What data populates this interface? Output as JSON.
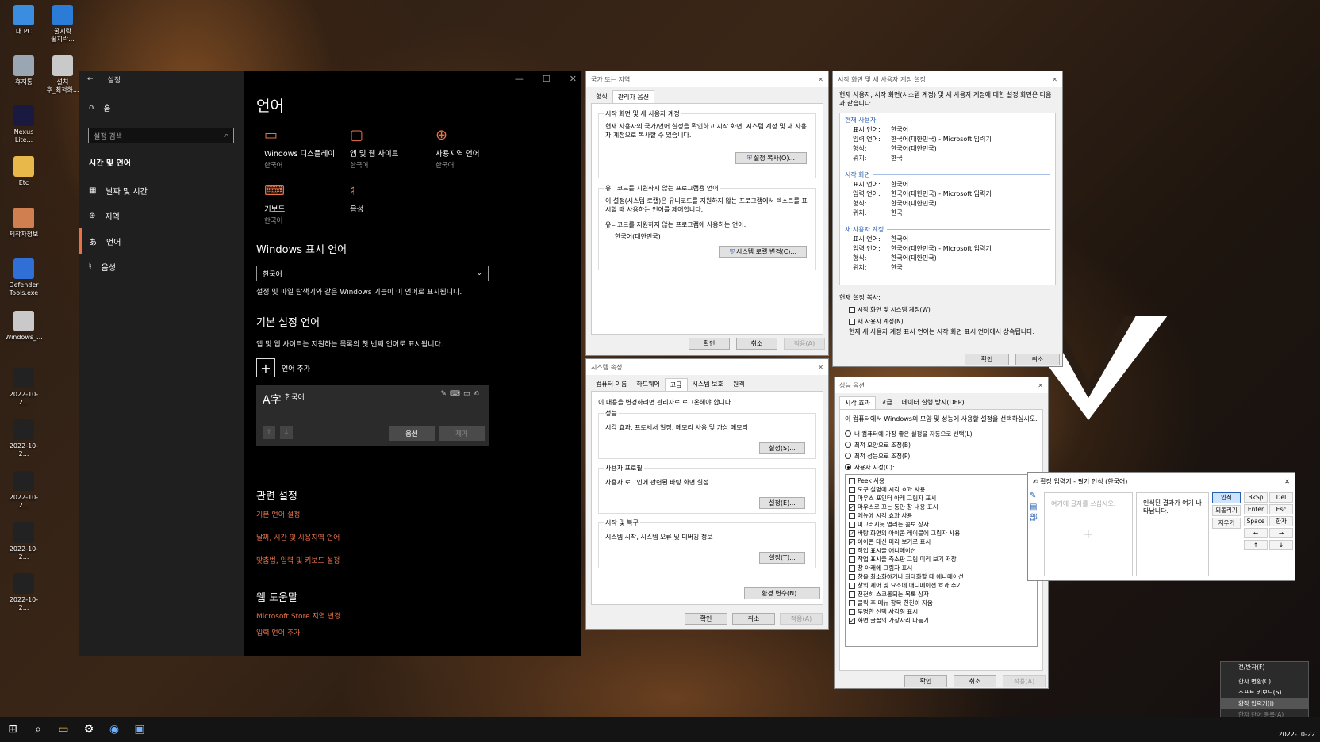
{
  "desktop": {
    "icons": [
      {
        "label": "내 PC",
        "color": "#3b8de0"
      },
      {
        "label": "꿀지락\n꿀지락...",
        "color": "#2b7cd6"
      },
      {
        "label": "휴지통",
        "color": "#9aa7b3"
      },
      {
        "label": "설치\n후_최적화...",
        "color": "#c9c9c9"
      },
      {
        "label": "Nexus\nLite...",
        "color": "#1a1a40"
      },
      {
        "label": "Etc",
        "color": "#e8b84a"
      },
      {
        "label": "제작자정보",
        "color": "#d08050"
      },
      {
        "label": "Defender\nTools.exe",
        "color": "#2f6fd6"
      },
      {
        "label": "Windows_...",
        "color": "#c9c9c9"
      },
      {
        "label": "2022-10-2...",
        "color": "#222"
      },
      {
        "label": "2022-10-2...",
        "color": "#222"
      },
      {
        "label": "2022-10-2...",
        "color": "#222"
      },
      {
        "label": "2022-10-2...",
        "color": "#222"
      },
      {
        "label": "2022-10-2...",
        "color": "#222"
      }
    ]
  },
  "settings": {
    "title": "설정",
    "home": "홈",
    "search_placeholder": "설정 검색",
    "group": "시간 및 언어",
    "nav": [
      "날짜 및 시간",
      "지역",
      "언어",
      "음성"
    ],
    "page_title": "언어",
    "tiles": [
      {
        "label": "Windows 디스플레이",
        "sub": "한국어",
        "icon": "monitor-icon"
      },
      {
        "label": "앱 및 웹 사이트",
        "sub": "한국어",
        "icon": "window-icon"
      },
      {
        "label": "사용지역 언어",
        "sub": "한국어",
        "icon": "globe-icon"
      },
      {
        "label": "키보드",
        "sub": "한국어",
        "icon": "keyboard-icon"
      },
      {
        "label": "음성",
        "sub": "",
        "icon": "microphone-icon"
      }
    ],
    "display_lang_heading": "Windows 표시 언어",
    "display_lang_value": "한국어",
    "display_lang_desc": "설정 및 파일 탐색기와 같은 Windows 기능이 이 언어로 표시됩니다.",
    "pref_heading": "기본 설정 언어",
    "pref_desc": "앱 및 웹 사이트는 지원하는 목록의 첫 번째 언어로 표시됩니다.",
    "add_lang": "언어 추가",
    "lang_item": "한국어",
    "options_btn": "옵션",
    "remove_btn": "제거",
    "related_heading": "관련 설정",
    "related_links": [
      "기본 언어 설정",
      "날짜, 시간 및 사용지역 언어",
      "맞춤법, 입력 및 키보드 설정"
    ],
    "help_heading": "웹 도움말",
    "help_links": [
      "Microsoft Store 지역 변경",
      "입력 언어 추가"
    ]
  },
  "region": {
    "title": "국가 또는 지역",
    "tabs": [
      "형식",
      "관리자 옵션"
    ],
    "grp1_title": "시작 화면 및 새 사용자 계정",
    "grp1_text": "현재 사용자의 국가/언어 설정을 확인하고 시작 화면, 시스템 계정 및 새 사용자 계정으로 복사할 수 있습니다.",
    "grp1_btn": "설정 복사(O)...",
    "grp2_title": "유니코드를 지원하지 않는 프로그램용 언어",
    "grp2_text": "이 설정(시스템 로캘)은 유니코드를 지원하지 않는 프로그램에서 텍스트를 표시할 때 사용하는 언어를 제어합니다.",
    "grp2_label": "유니코드를 지원하지 않는 프로그램에 사용하는 언어:",
    "grp2_value": "한국어(대한민국)",
    "grp2_btn": "시스템 로캘 변경(C)...",
    "ok": "확인",
    "cancel": "취소",
    "apply": "적용(A)"
  },
  "welcome": {
    "title": "시작 화면 및 새 사용자 계정 설정",
    "desc": "현재 사용자, 시작 화면(시스템 계정) 및 새 사용자 계정에 대한 설정 화면은 다음과 같습니다.",
    "sections": [
      {
        "name": "현재 사용자",
        "rows": [
          [
            "표시 언어:",
            "한국어"
          ],
          [
            "입력 언어:",
            "한국어(대한민국) - Microsoft 입력기"
          ],
          [
            "형식:",
            "한국어(대한민국)"
          ],
          [
            "위치:",
            "한국"
          ]
        ]
      },
      {
        "name": "시작 화면",
        "rows": [
          [
            "표시 언어:",
            "한국어"
          ],
          [
            "입력 언어:",
            "한국어(대한민국) - Microsoft 입력기"
          ],
          [
            "형식:",
            "한국어(대한민국)"
          ],
          [
            "위치:",
            "한국"
          ]
        ]
      },
      {
        "name": "새 사용자 계정",
        "rows": [
          [
            "표시 언어:",
            "한국어"
          ],
          [
            "입력 언어:",
            "한국어(대한민국) - Microsoft 입력기"
          ],
          [
            "형식:",
            "한국어(대한민국)"
          ],
          [
            "위치:",
            "한국"
          ]
        ]
      }
    ],
    "copy_label": "현재 설정 복사:",
    "cb1": "시작 화면 및 시스템 계정(W)",
    "cb2": "새 사용자 계정(N)",
    "note": "현재 새 사용자 계정 표시 언어는 시작 화면 표시 언어에서 상속됩니다.",
    "ok": "확인",
    "cancel": "취소"
  },
  "sysprop": {
    "title": "시스템 속성",
    "tabs": [
      "컴퓨터 이름",
      "하드웨어",
      "고급",
      "시스템 보호",
      "원격"
    ],
    "admin_note": "이 내용을 변경하려면 관리자로 로그온해야 합니다.",
    "g1_title": "성능",
    "g1_text": "시각 효과, 프로세서 일정, 메모리 사용 및 가상 메모리",
    "g1_btn": "설정(S)...",
    "g2_title": "사용자 프로필",
    "g2_text": "사용자 로그인에 관련된 바탕 화면 설정",
    "g2_btn": "설정(E)...",
    "g3_title": "시작 및 복구",
    "g3_text": "시스템 시작, 시스템 오류 및 디버깅 정보",
    "g3_btn": "설정(T)...",
    "env_btn": "환경 변수(N)...",
    "ok": "확인",
    "cancel": "취소",
    "apply": "적용(A)"
  },
  "perf": {
    "title": "성능 옵션",
    "tabs": [
      "시각 효과",
      "고급",
      "데이터 실행 방지(DEP)"
    ],
    "desc": "이 컴퓨터에서 Windows의 모양 및 성능에 사용할 설정을 선택하십시오.",
    "radios": [
      {
        "label": "내 컴퓨터에 가장 좋은 설정을 자동으로 선택(L)",
        "on": false
      },
      {
        "label": "최적 모양으로 조정(B)",
        "on": false
      },
      {
        "label": "최적 성능으로 조정(P)",
        "on": false
      },
      {
        "label": "사용자 지정(C):",
        "on": true
      }
    ],
    "checks": [
      {
        "label": "Peek 사용",
        "on": false
      },
      {
        "label": "도구 설명에 시각 효과 사용",
        "on": false
      },
      {
        "label": "마우스 포인터 아래 그림자 표시",
        "on": false
      },
      {
        "label": "마우스로 끄는 동안 창 내용 표시",
        "on": true
      },
      {
        "label": "메뉴에 시각 효과 사용",
        "on": false
      },
      {
        "label": "미끄러지듯 열리는 콤보 상자",
        "on": false
      },
      {
        "label": "바탕 화면의 아이콘 레이블에 그림자 사용",
        "on": true
      },
      {
        "label": "아이콘 대신 미리 보기로 표시",
        "on": true
      },
      {
        "label": "작업 표시줄 애니메이션",
        "on": false
      },
      {
        "label": "작업 표시줄 축소판 그림 미리 보기 저장",
        "on": false
      },
      {
        "label": "창 아래에 그림자 표시",
        "on": false
      },
      {
        "label": "창을 최소화하거나 최대화할 때 애니메이션",
        "on": false
      },
      {
        "label": "창의 제어 및 요소에 애니메이션 효과 주기",
        "on": false
      },
      {
        "label": "천천히 스크롤되는 목록 상자",
        "on": false
      },
      {
        "label": "클릭 후 메뉴 항목 천천히 지움",
        "on": false
      },
      {
        "label": "투명한 선택 사각형 표시",
        "on": false
      },
      {
        "label": "화면 글꼴의 가장자리 다듬기",
        "on": true
      }
    ],
    "ok": "확인",
    "cancel": "취소",
    "apply": "적용(A)"
  },
  "ime": {
    "title": "확장 입력기 - 필기 인식 (한국어)",
    "placeholder": "여기에 글자를 쓰십시오.",
    "result": "인식된 결과가 여기 나타납니다.",
    "btns": [
      "인식",
      "되돌리기",
      "지우기"
    ],
    "keys": [
      "BkSp",
      "Del",
      "Enter",
      "Esc",
      "Space",
      "한자",
      "←",
      "→",
      "↑",
      "↓"
    ]
  },
  "imemenu": {
    "items": [
      "전/반자(F)",
      "한자 변환(C)",
      "소프트 키보드(S)",
      "확장 입력기(I)",
      "한자 단어 등록(A)"
    ]
  },
  "clock": {
    "date": "2022-10-22"
  }
}
